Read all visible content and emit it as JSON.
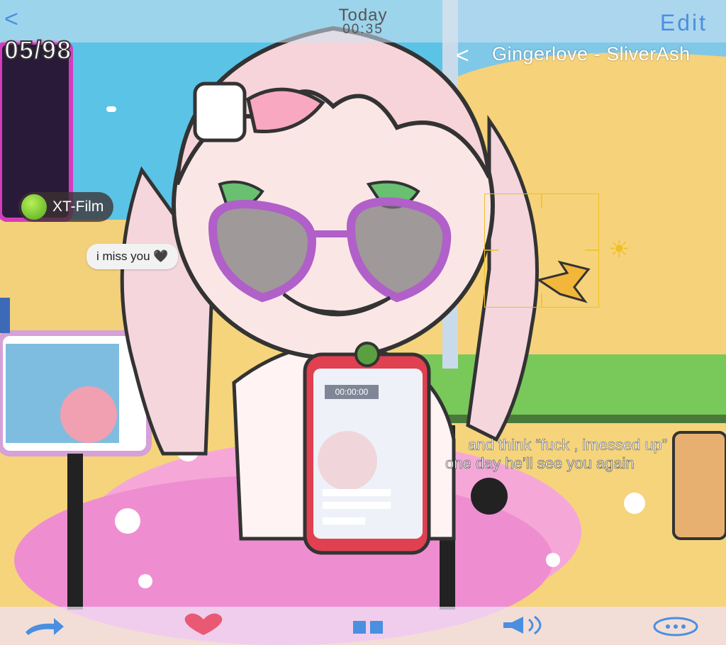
{
  "header": {
    "back_glyph": "<",
    "counter": "05/98",
    "date_label": "Today",
    "time": "00:35",
    "edit_label": "Edit"
  },
  "song": {
    "back_glyph": "<",
    "title": "Gingerlove - SliverAsh"
  },
  "badge": {
    "label": "XT-Film"
  },
  "message": {
    "text": "i miss you 🖤"
  },
  "camera": {
    "focus_icon": "sun-icon",
    "sun_glyph": "☀"
  },
  "phone": {
    "recording_time": "00:00:00"
  },
  "subtitles": {
    "line1": "and think “fuck , imessed up”",
    "line2": "one day he’ll see you again"
  },
  "toolbar": {
    "icons": [
      "share-arrow-icon",
      "heart-icon",
      "pause-icon",
      "volume-icon",
      "more-icon"
    ]
  },
  "colors": {
    "accent": "#4a8fe0",
    "focus": "#f0c020",
    "heart": "#e85a74"
  }
}
